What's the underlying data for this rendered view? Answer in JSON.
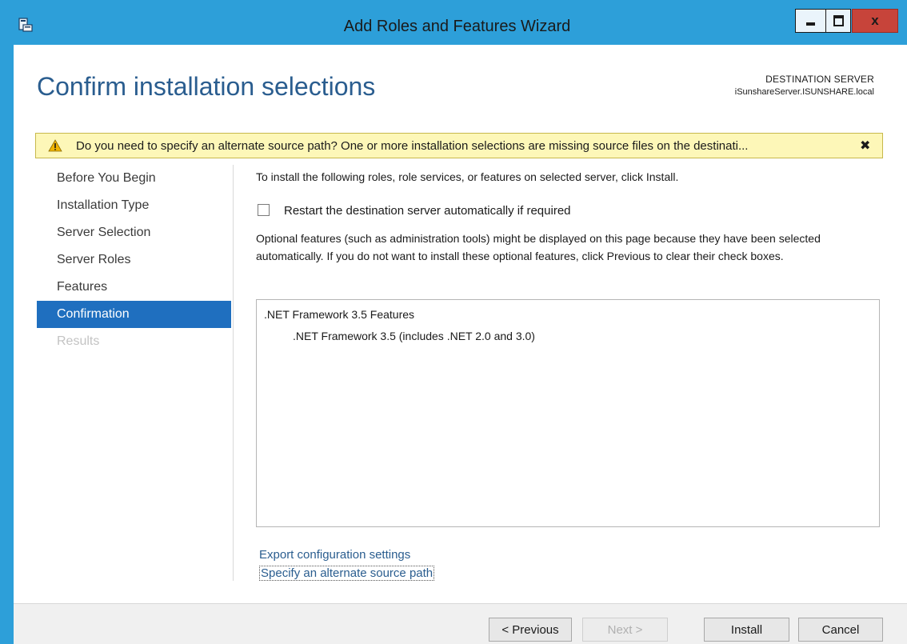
{
  "window": {
    "title": "Add Roles and Features Wizard",
    "icons": {
      "app": "server-manager-icon",
      "minimize": "minimize-icon",
      "maximize": "maximize-icon",
      "close": "close-icon"
    },
    "close_glyph": "x"
  },
  "header": {
    "page_title": "Confirm installation selections",
    "destination_label": "DESTINATION SERVER",
    "destination_value": "iSunshareServer.ISUNSHARE.local"
  },
  "warning": {
    "text": "Do you need to specify an alternate source path? One or more installation selections are missing source files on the destinati...",
    "icon": "warning-icon",
    "dismiss_glyph": "✖"
  },
  "nav": {
    "items": [
      {
        "label": "Before You Begin",
        "state": "normal"
      },
      {
        "label": "Installation Type",
        "state": "normal"
      },
      {
        "label": "Server Selection",
        "state": "normal"
      },
      {
        "label": "Server Roles",
        "state": "normal"
      },
      {
        "label": "Features",
        "state": "normal"
      },
      {
        "label": "Confirmation",
        "state": "active"
      },
      {
        "label": "Results",
        "state": "disabled"
      }
    ]
  },
  "main": {
    "intro": "To install the following roles, role services, or features on selected server, click Install.",
    "restart_checkbox": {
      "label": "Restart the destination server automatically if required",
      "checked": false
    },
    "optional_note": "Optional features (such as administration tools) might be displayed on this page because they have been selected automatically. If you do not want to install these optional features, click Previous to clear their check boxes.",
    "features": {
      "parent": ".NET Framework 3.5 Features",
      "child": ".NET Framework 3.5 (includes .NET 2.0 and 3.0)"
    },
    "links": {
      "export": "Export configuration settings",
      "alternate_source": "Specify an alternate source path"
    }
  },
  "footer": {
    "previous": "< Previous",
    "next": "Next >",
    "install": "Install",
    "cancel": "Cancel"
  },
  "colors": {
    "accent": "#2d9fd9",
    "nav_active": "#1f6fbf",
    "title_text": "#2a5d8f",
    "warning_bg": "#fdf7b8",
    "close_button": "#c7443a"
  }
}
